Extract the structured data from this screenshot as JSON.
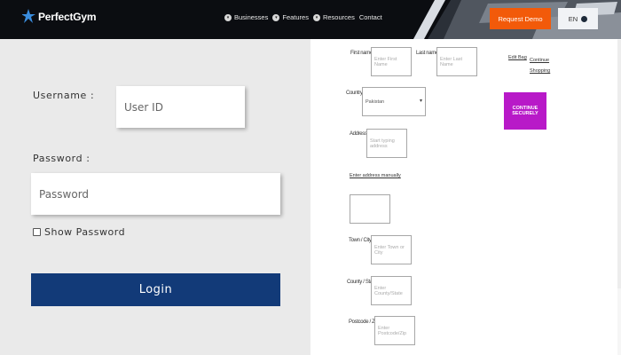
{
  "header": {
    "logo_text": "PerfectGym",
    "nav": [
      {
        "label": "Businesses"
      },
      {
        "label": "Features"
      },
      {
        "label": "Resources"
      },
      {
        "label": "Contact"
      }
    ],
    "demo_button": "Request Demo",
    "language_button": "EN"
  },
  "login": {
    "username_label": "Username :",
    "username_placeholder": "User ID",
    "password_label": "Password :",
    "password_placeholder": "Password",
    "show_password_label": "Show Password",
    "show_password_checked": false,
    "login_button": "Login"
  },
  "checkout": {
    "first_name_label": "First name*",
    "first_name_placeholder": "Enter First Name",
    "last_name_label": "Last name*",
    "last_name_placeholder": "Enter Last Name",
    "country_label": "Country",
    "country_value": "Pakistan",
    "address_label": "Address*",
    "address_placeholder": "Start typing address",
    "manual_address_link": "Enter address manually",
    "town_label": "Town / City*",
    "town_placeholder": "Enter Town or City",
    "county_label": "County / State",
    "county_placeholder": "Enter County/State",
    "postcode_label": "Postcode / Zip*",
    "postcode_placeholder": "Enter Postcode/Zip",
    "edit_bag_link": "Edit Bag",
    "continue_shopping_link": "Continue Shopping",
    "continue_button": "CONTINUE SECURELY"
  },
  "colors": {
    "header_bg": "#0b0d11",
    "accent_orange": "#f25a0a",
    "login_button_bg": "#123a78",
    "secure_button_bg": "#b819c8",
    "login_panel_bg": "#eaeaea"
  },
  "icons": {
    "logo": "star-figure-icon",
    "nav_items": "circle-dot-icon",
    "language": "globe-icon",
    "country_dropdown": "chevron-down-icon"
  }
}
